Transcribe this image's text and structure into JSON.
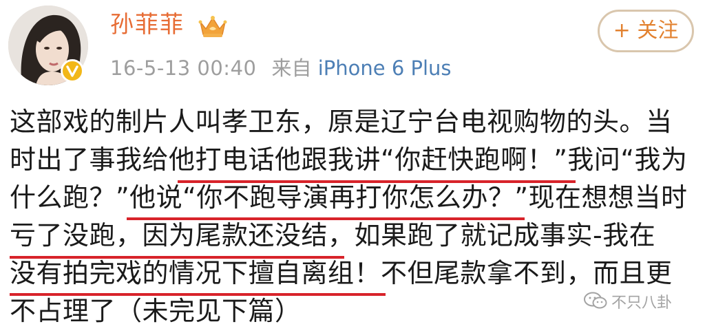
{
  "post": {
    "username": "孙菲菲",
    "timestamp": "16-5-13 00:40",
    "source_prefix": "来自",
    "device": "iPhone 6 Plus",
    "follow_label": "+ 关注",
    "content_lines": [
      "这部戏的制片人叫孝卫东，原是辽宁台电视购物的头。当",
      "时出了事我给他打电话他跟我讲“你赶快跑啊！”我问“我为",
      "什么跑？”他说“你不跑导演再打你怎么办？”现在想想当时",
      "亏了没跑，因为尾款还没结，如果跑了就记成事实-我在",
      "没有拍完戏的情况下擅自离组！不但尾款拿不到，而且更",
      "不占理了（未完见下篇）"
    ]
  },
  "watermark": {
    "text": "不只八卦",
    "icon": "wechat-icon"
  },
  "icons": {
    "verified_badge": "verified-v-icon",
    "member_crown": "crown-icon"
  },
  "colors": {
    "username": "#e76c34",
    "device_link": "#4d7fb5",
    "meta_gray": "#9e9e9e",
    "underline_red": "#d8232a",
    "verified_yellow": "#f2b718",
    "follow_text": "#e2812f"
  }
}
